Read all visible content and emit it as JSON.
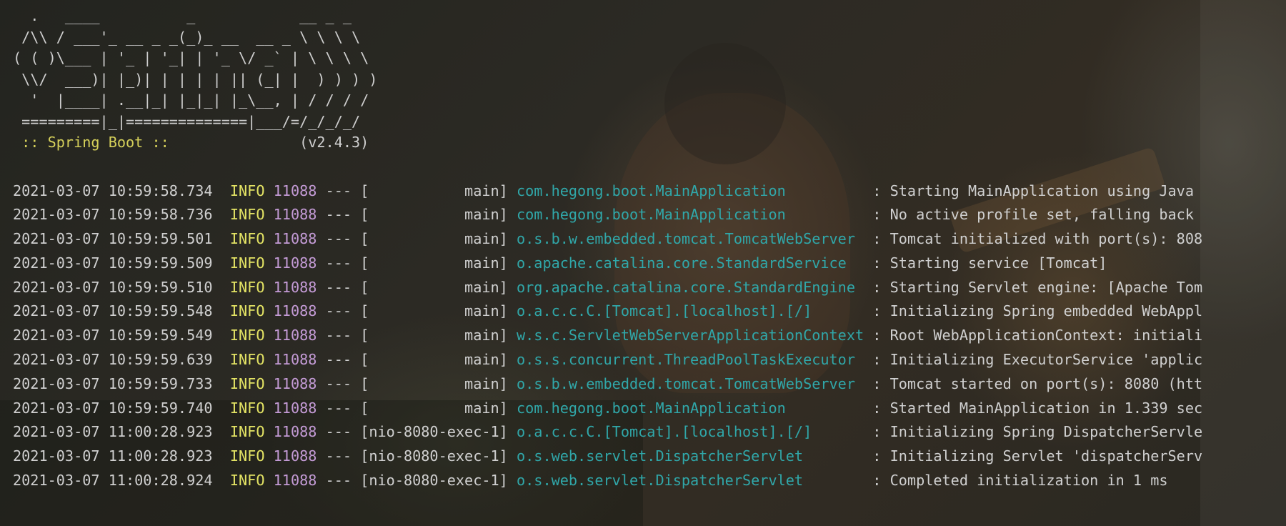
{
  "banner": {
    "lines": [
      "  .   ____          _            __ _ _",
      " /\\\\ / ___'_ __ _ _(_)_ __  __ _ \\ \\ \\ \\",
      "( ( )\\___ | '_ | '_| | '_ \\/ _` | \\ \\ \\ \\",
      " \\\\/  ___)| |_)| | | | | || (_| |  ) ) ) )",
      "  '  |____| .__|_| |_|_| |_\\__, | / / / /",
      " =========|_|==============|___/=/_/_/_/"
    ],
    "spring_label": " :: Spring Boot :: ",
    "spring_padding": "              ",
    "version": "(v2.4.3)"
  },
  "log": {
    "colors": {
      "level": "#e3e364",
      "pid": "#c49bd6",
      "logger": "#30a7a9",
      "text": "#d0d0d0",
      "banner_accent": "#d5d05a"
    },
    "rows": [
      {
        "timestamp": "2021-03-07 10:59:58.734",
        "level": "INFO",
        "pid": "11088",
        "separator": "---",
        "thread": "[           main]",
        "logger": "com.hegong.boot.MainApplication         ",
        "message": ": Starting MainApplication using Java"
      },
      {
        "timestamp": "2021-03-07 10:59:58.736",
        "level": "INFO",
        "pid": "11088",
        "separator": "---",
        "thread": "[           main]",
        "logger": "com.hegong.boot.MainApplication         ",
        "message": ": No active profile set, falling back"
      },
      {
        "timestamp": "2021-03-07 10:59:59.501",
        "level": "INFO",
        "pid": "11088",
        "separator": "---",
        "thread": "[           main]",
        "logger": "o.s.b.w.embedded.tomcat.TomcatWebServer ",
        "message": ": Tomcat initialized with port(s): 808"
      },
      {
        "timestamp": "2021-03-07 10:59:59.509",
        "level": "INFO",
        "pid": "11088",
        "separator": "---",
        "thread": "[           main]",
        "logger": "o.apache.catalina.core.StandardService  ",
        "message": ": Starting service [Tomcat]"
      },
      {
        "timestamp": "2021-03-07 10:59:59.510",
        "level": "INFO",
        "pid": "11088",
        "separator": "---",
        "thread": "[           main]",
        "logger": "org.apache.catalina.core.StandardEngine ",
        "message": ": Starting Servlet engine: [Apache Tom"
      },
      {
        "timestamp": "2021-03-07 10:59:59.548",
        "level": "INFO",
        "pid": "11088",
        "separator": "---",
        "thread": "[           main]",
        "logger": "o.a.c.c.C.[Tomcat].[localhost].[/]      ",
        "message": ": Initializing Spring embedded WebAppl"
      },
      {
        "timestamp": "2021-03-07 10:59:59.549",
        "level": "INFO",
        "pid": "11088",
        "separator": "---",
        "thread": "[           main]",
        "logger": "w.s.c.ServletWebServerApplicationContext",
        "message": ": Root WebApplicationContext: initiali"
      },
      {
        "timestamp": "2021-03-07 10:59:59.639",
        "level": "INFO",
        "pid": "11088",
        "separator": "---",
        "thread": "[           main]",
        "logger": "o.s.s.concurrent.ThreadPoolTaskExecutor ",
        "message": ": Initializing ExecutorService 'applic"
      },
      {
        "timestamp": "2021-03-07 10:59:59.733",
        "level": "INFO",
        "pid": "11088",
        "separator": "---",
        "thread": "[           main]",
        "logger": "o.s.b.w.embedded.tomcat.TomcatWebServer ",
        "message": ": Tomcat started on port(s): 8080 (htt"
      },
      {
        "timestamp": "2021-03-07 10:59:59.740",
        "level": "INFO",
        "pid": "11088",
        "separator": "---",
        "thread": "[           main]",
        "logger": "com.hegong.boot.MainApplication         ",
        "message": ": Started MainApplication in 1.339 sec"
      },
      {
        "timestamp": "2021-03-07 11:00:28.923",
        "level": "INFO",
        "pid": "11088",
        "separator": "---",
        "thread": "[nio-8080-exec-1]",
        "logger": "o.a.c.c.C.[Tomcat].[localhost].[/]      ",
        "message": ": Initializing Spring DispatcherServle"
      },
      {
        "timestamp": "2021-03-07 11:00:28.923",
        "level": "INFO",
        "pid": "11088",
        "separator": "---",
        "thread": "[nio-8080-exec-1]",
        "logger": "o.s.web.servlet.DispatcherServlet       ",
        "message": ": Initializing Servlet 'dispatcherServ"
      },
      {
        "timestamp": "2021-03-07 11:00:28.924",
        "level": "INFO",
        "pid": "11088",
        "separator": "---",
        "thread": "[nio-8080-exec-1]",
        "logger": "o.s.web.servlet.DispatcherServlet       ",
        "message": ": Completed initialization in 1 ms"
      }
    ]
  }
}
